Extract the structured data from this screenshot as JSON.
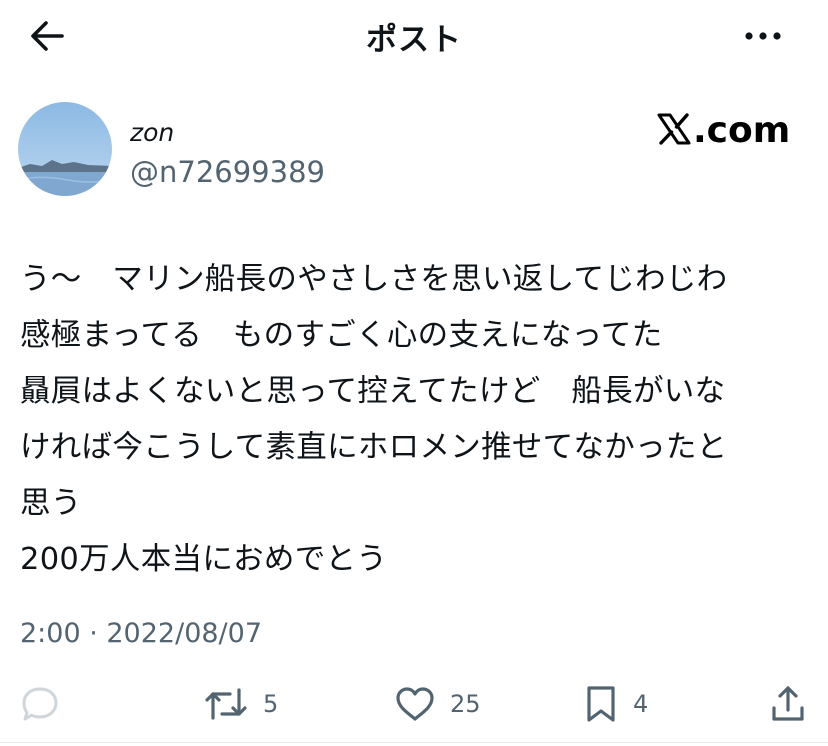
{
  "header": {
    "title": "ポスト"
  },
  "user": {
    "display_name": "zon",
    "handle": "@n72699389"
  },
  "brand": {
    "text": ".com"
  },
  "tweet": {
    "lines": [
      "う〜　マリン船長のやさしさを思い返してじわじわ",
      "感極まってる　ものすごく心の支えになってた",
      "贔屓はよくないと思って控えてたけど　船長がいな",
      "ければ今こうして素直にホロメン推せてなかったと",
      "思う",
      "200万人本当におめでとう"
    ]
  },
  "meta": {
    "timestamp": "2:00 · 2022/08/07"
  },
  "actions": {
    "reply_count": "",
    "repost_count": "5",
    "like_count": "25",
    "bookmark_count": "4"
  },
  "colors": {
    "text": "#0f1419",
    "secondary": "#536471",
    "reply_icon_faded": "#d0d5d9"
  }
}
